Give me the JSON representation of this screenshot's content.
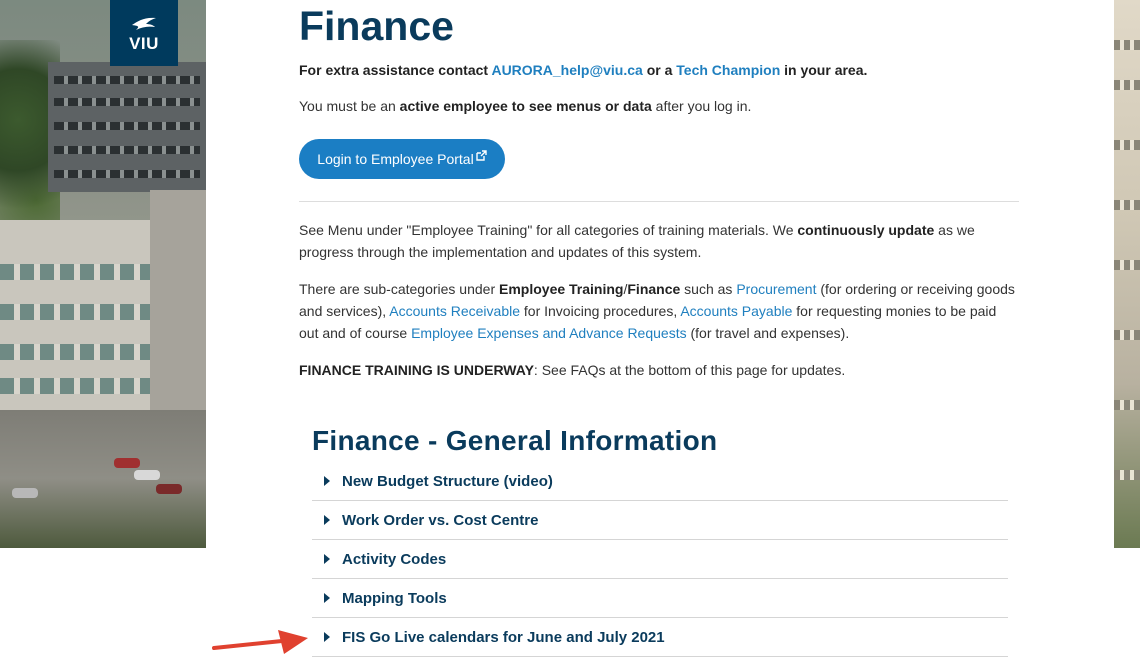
{
  "logo": {
    "text": "VIU"
  },
  "page": {
    "title": "Finance"
  },
  "contact": {
    "prefix": "For extra assistance contact ",
    "email": "AURORA_help@viu.ca",
    "middle": " or a ",
    "champion": "Tech Champion",
    "suffix": " in your area."
  },
  "notice": {
    "prefix": "You must be an ",
    "bold": "active employee to see menus or data",
    "suffix": " after you log in."
  },
  "portal_button": {
    "label": "Login to Employee Portal"
  },
  "training": {
    "prefix": "See Menu under \"Employee Training\" for all categories of training materials. We ",
    "bold": "continuously update",
    "suffix": " as we progress through the implementation and updates of this system."
  },
  "subcats": {
    "t1": "There are sub-categories under ",
    "b1": "Employee Training",
    "t2": "/",
    "b2": "Finance",
    "t3": " such as ",
    "l1": "Procurement",
    "t4": " (for ordering or receiving goods and services), ",
    "l2": "Accounts Receivable",
    "t5": " for Invoicing procedures, ",
    "l3": "Accounts Payable",
    "t6": " for requesting monies to be paid out and of course ",
    "l4": "Employee Expenses and Advance Requests",
    "t7": " (for travel and expenses)."
  },
  "underway": {
    "bold": "FINANCE TRAINING IS UNDERWAY",
    "suffix": ": See FAQs at the bottom of this page for updates."
  },
  "section": {
    "title": "Finance - General Information"
  },
  "accordion": [
    {
      "label": "New Budget Structure (video)"
    },
    {
      "label": "Work Order vs. Cost Centre"
    },
    {
      "label": "Activity Codes"
    },
    {
      "label": "Mapping Tools"
    },
    {
      "label": "FIS Go Live calendars for June and July 2021"
    }
  ],
  "colors": {
    "navy": "#0a3b5c",
    "link": "#1f7fbf",
    "button": "#1b7ec4",
    "arrow": "#e0412f"
  }
}
